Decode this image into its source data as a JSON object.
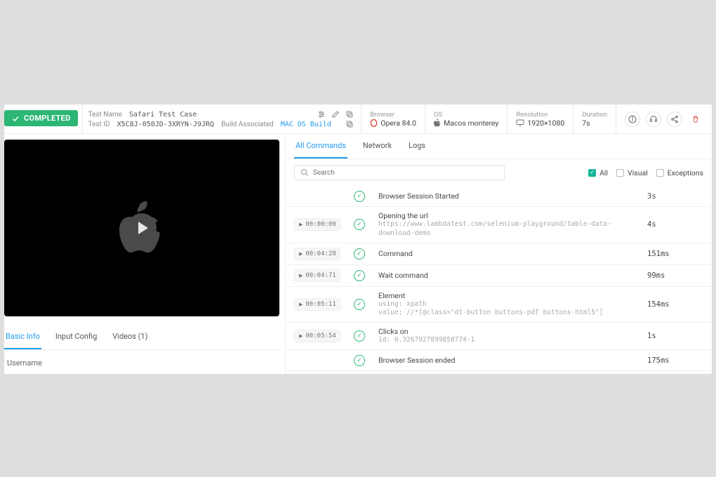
{
  "status": {
    "label": "COMPLETED"
  },
  "test": {
    "name_label": "Test Name",
    "name_value": "Safari Test Case",
    "id_label": "Test ID",
    "id_value": "X5C8J-050JD-3XRYN-J9JRQ",
    "build_assoc_label": "Build Associated",
    "build_assoc_value": "MAC OS Build"
  },
  "env": {
    "browser_label": "Browser",
    "browser_value": "Opera 84.0",
    "os_label": "OS",
    "os_value": "Macos monterey",
    "resolution_label": "Resolution",
    "resolution_value": "1920×1080",
    "duration_label": "Duration",
    "duration_value": "7s"
  },
  "left_tabs": {
    "basic": "Basic Info",
    "input": "Input Config",
    "videos": "Videos (1)"
  },
  "basic_info": {
    "username_label": "Username"
  },
  "right_tabs": {
    "all_commands": "All Commands",
    "network": "Network",
    "logs": "Logs"
  },
  "search": {
    "placeholder": "Search"
  },
  "filters": {
    "all": "All",
    "visual": "Visual",
    "exceptions": "Exceptions"
  },
  "commands": [
    {
      "ts": "",
      "title": "Browser Session Started",
      "sub": "",
      "duration": "3s"
    },
    {
      "ts": "00:00:00",
      "title": "Opening the url",
      "sub": "https://www.lambdatest.com/selenium-playground/table-data-download-demo",
      "duration": "4s"
    },
    {
      "ts": "00:04:28",
      "title": "Command",
      "sub": "",
      "duration": "151ms"
    },
    {
      "ts": "00:04:71",
      "title": "Wait command",
      "sub": "",
      "duration": "99ms"
    },
    {
      "ts": "00:05:11",
      "title": "Element",
      "sub": "using: xpath\nvalue: //*[@class=\"dt-button buttons-pdf buttons-html5\"]",
      "duration": "154ms"
    },
    {
      "ts": "00:05:54",
      "title": "Clicks on",
      "sub": "id: 0.3267927899858774-1",
      "duration": "1s"
    },
    {
      "ts": "",
      "title": "Browser Session ended",
      "sub": "",
      "duration": "175ms"
    }
  ]
}
